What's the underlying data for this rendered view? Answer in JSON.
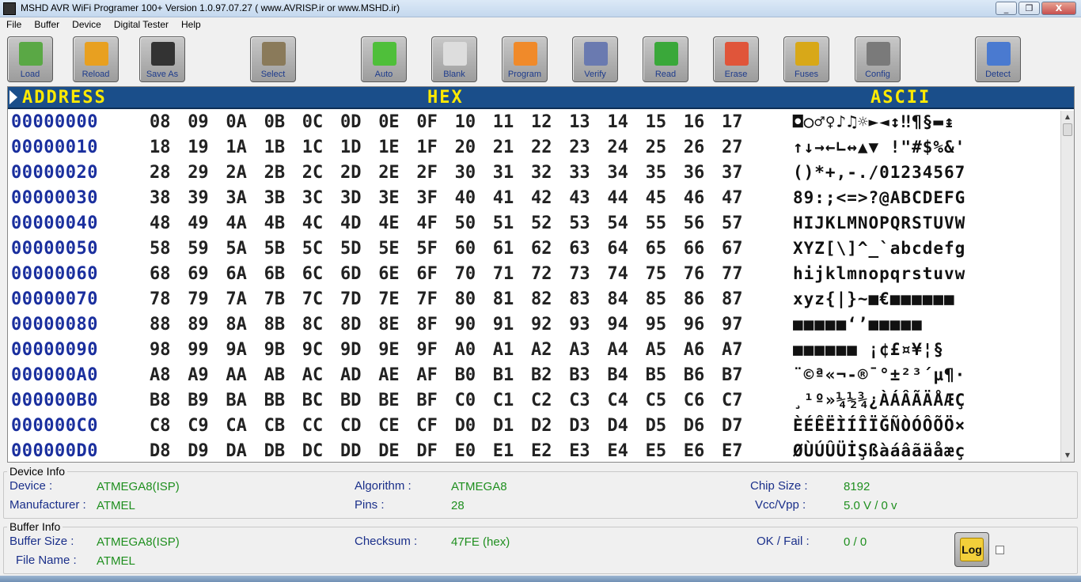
{
  "window": {
    "title": "MSHD AVR WiFi Programer 100+ Version 1.0.97.07.27 ( www.AVRISP.ir or www.MSHD.ir)",
    "controls": [
      "_",
      "❐",
      "X"
    ]
  },
  "menu": [
    "File",
    "Buffer",
    "Device",
    "Digital Tester",
    "Help"
  ],
  "toolbar": [
    {
      "label": "Load",
      "icon": "folder-load-icon",
      "color": "#5aa845"
    },
    {
      "label": "Reload",
      "icon": "reload-icon",
      "color": "#e8a020"
    },
    {
      "label": "Save As",
      "icon": "floppy-disk-icon",
      "color": "#333333"
    },
    {
      "label": "Select",
      "icon": "chip-select-icon",
      "color": "#8a7a5a"
    },
    {
      "label": "Auto",
      "icon": "arrow-right-icon",
      "color": "#4fbf3a"
    },
    {
      "label": "Blank",
      "icon": "magnifier-blank-icon",
      "color": "#dddddd"
    },
    {
      "label": "Program",
      "icon": "download-arrow-icon",
      "color": "#f08a2a"
    },
    {
      "label": "Verify",
      "icon": "magnifier-verify-icon",
      "color": "#6a7ab0"
    },
    {
      "label": "Read",
      "icon": "upload-arrow-icon",
      "color": "#3aa83a"
    },
    {
      "label": "Erase",
      "icon": "eraser-icon",
      "color": "#e0553a"
    },
    {
      "label": "Fuses",
      "icon": "padlock-icon",
      "color": "#d8a818"
    },
    {
      "label": "Config",
      "icon": "tools-config-icon",
      "color": "#7a7a7a"
    },
    {
      "label": "Detect",
      "icon": "chip-detect-icon",
      "color": "#4a7ad0"
    }
  ],
  "hex_view": {
    "headers": {
      "address": "ADDRESS",
      "hex": "HEX",
      "ascii": "ASCII"
    },
    "rows": [
      {
        "address": "00000000",
        "bytes": [
          "08",
          "09",
          "0A",
          "0B",
          "0C",
          "0D",
          "0E",
          "0F",
          "10",
          "11",
          "12",
          "13",
          "14",
          "15",
          "16",
          "17"
        ],
        "ascii": "◘○♂♀♪♫☼►◄↕‼¶§▬↨"
      },
      {
        "address": "00000010",
        "bytes": [
          "18",
          "19",
          "1A",
          "1B",
          "1C",
          "1D",
          "1E",
          "1F",
          "20",
          "21",
          "22",
          "23",
          "24",
          "25",
          "26",
          "27"
        ],
        "ascii": "↑↓→←∟↔▲▼ !\"#$%&'"
      },
      {
        "address": "00000020",
        "bytes": [
          "28",
          "29",
          "2A",
          "2B",
          "2C",
          "2D",
          "2E",
          "2F",
          "30",
          "31",
          "32",
          "33",
          "34",
          "35",
          "36",
          "37"
        ],
        "ascii": "()*+,-./01234567"
      },
      {
        "address": "00000030",
        "bytes": [
          "38",
          "39",
          "3A",
          "3B",
          "3C",
          "3D",
          "3E",
          "3F",
          "40",
          "41",
          "42",
          "43",
          "44",
          "45",
          "46",
          "47"
        ],
        "ascii": "89:;<=>?@ABCDEFG"
      },
      {
        "address": "00000040",
        "bytes": [
          "48",
          "49",
          "4A",
          "4B",
          "4C",
          "4D",
          "4E",
          "4F",
          "50",
          "51",
          "52",
          "53",
          "54",
          "55",
          "56",
          "57"
        ],
        "ascii": "HIJKLMNOPQRSTUVW"
      },
      {
        "address": "00000050",
        "bytes": [
          "58",
          "59",
          "5A",
          "5B",
          "5C",
          "5D",
          "5E",
          "5F",
          "60",
          "61",
          "62",
          "63",
          "64",
          "65",
          "66",
          "67"
        ],
        "ascii": "XYZ[\\]^_`abcdefg"
      },
      {
        "address": "00000060",
        "bytes": [
          "68",
          "69",
          "6A",
          "6B",
          "6C",
          "6D",
          "6E",
          "6F",
          "70",
          "71",
          "72",
          "73",
          "74",
          "75",
          "76",
          "77"
        ],
        "ascii": "hijklmnopqrstuvw"
      },
      {
        "address": "00000070",
        "bytes": [
          "78",
          "79",
          "7A",
          "7B",
          "7C",
          "7D",
          "7E",
          "7F",
          "80",
          "81",
          "82",
          "83",
          "84",
          "85",
          "86",
          "87"
        ],
        "ascii": "xyz{|}~■€■■■■■■"
      },
      {
        "address": "00000080",
        "bytes": [
          "88",
          "89",
          "8A",
          "8B",
          "8C",
          "8D",
          "8E",
          "8F",
          "90",
          "91",
          "92",
          "93",
          "94",
          "95",
          "96",
          "97"
        ],
        "ascii": "■■■■■‘’■■■■■"
      },
      {
        "address": "00000090",
        "bytes": [
          "98",
          "99",
          "9A",
          "9B",
          "9C",
          "9D",
          "9E",
          "9F",
          "A0",
          "A1",
          "A2",
          "A3",
          "A4",
          "A5",
          "A6",
          "A7"
        ],
        "ascii": "■■■■■■ ¡¢£¤¥¦§"
      },
      {
        "address": "000000A0",
        "bytes": [
          "A8",
          "A9",
          "AA",
          "AB",
          "AC",
          "AD",
          "AE",
          "AF",
          "B0",
          "B1",
          "B2",
          "B3",
          "B4",
          "B5",
          "B6",
          "B7"
        ],
        "ascii": "¨©ª«¬-®¯°±²³´µ¶·"
      },
      {
        "address": "000000B0",
        "bytes": [
          "B8",
          "B9",
          "BA",
          "BB",
          "BC",
          "BD",
          "BE",
          "BF",
          "C0",
          "C1",
          "C2",
          "C3",
          "C4",
          "C5",
          "C6",
          "C7"
        ],
        "ascii": "¸¹º»¼½¾¿ÀÁÂÃÄÅÆÇ"
      },
      {
        "address": "000000C0",
        "bytes": [
          "C8",
          "C9",
          "CA",
          "CB",
          "CC",
          "CD",
          "CE",
          "CF",
          "D0",
          "D1",
          "D2",
          "D3",
          "D4",
          "D5",
          "D6",
          "D7"
        ],
        "ascii": "ÈÉÊËÌÍÎÏĞÑÒÓÔÕÖ×"
      },
      {
        "address": "000000D0",
        "bytes": [
          "D8",
          "D9",
          "DA",
          "DB",
          "DC",
          "DD",
          "DE",
          "DF",
          "E0",
          "E1",
          "E2",
          "E3",
          "E4",
          "E5",
          "E6",
          "E7"
        ],
        "ascii": "ØÙÚÛÜİŞßàáâãäåæç"
      }
    ]
  },
  "device_info": {
    "legend": "Device Info",
    "device_label": "Device :",
    "device_value": "ATMEGA8(ISP)",
    "manufacturer_label": "Manufacturer :",
    "manufacturer_value": "ATMEL",
    "algorithm_label": "Algorithm :",
    "algorithm_value": "ATMEGA8",
    "pins_label": "Pins :",
    "pins_value": "28",
    "chip_size_label": "Chip Size :",
    "chip_size_value": "8192",
    "vcc_label": "Vcc/Vpp :",
    "vcc_value": "5.0 V / 0 v"
  },
  "buffer_info": {
    "legend": "Buffer Info",
    "buffer_size_label": "Buffer Size :",
    "buffer_size_value": "ATMEGA8(ISP)",
    "file_name_label": "File Name :",
    "file_name_value": "ATMEL",
    "checksum_label": "Checksum :",
    "checksum_value": "47FE  (hex)",
    "okfail_label": "OK / Fail :",
    "okfail_value": "0 / 0",
    "log_label": "Log"
  }
}
